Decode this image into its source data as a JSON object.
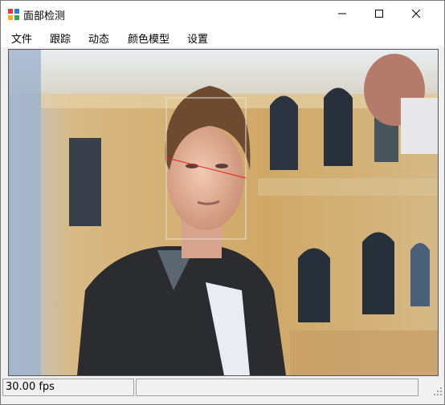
{
  "window": {
    "title": "面部检测"
  },
  "menu": {
    "items": [
      "文件",
      "跟踪",
      "动态",
      "颜色模型",
      "设置"
    ]
  },
  "status": {
    "fps_text": "30.00 fps",
    "secondary_text": ""
  },
  "detection": {
    "box_color": "#e8e0d0",
    "line_color": "#e02020"
  }
}
